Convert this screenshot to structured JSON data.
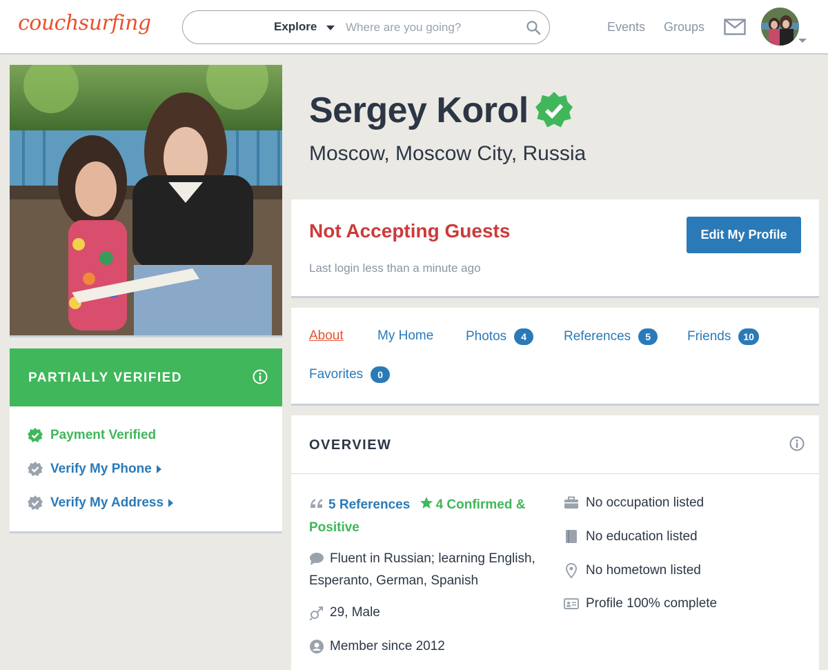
{
  "header": {
    "logo": "couchsurfing",
    "search": {
      "mode": "Explore",
      "placeholder": "Where are you going?"
    },
    "nav": [
      "Events",
      "Groups"
    ],
    "icons": [
      "search-icon",
      "mail-icon",
      "avatar"
    ]
  },
  "profile": {
    "name": "Sergey Korol",
    "location": "Moscow, Moscow City, Russia"
  },
  "verification": {
    "title": "PARTIALLY VERIFIED",
    "items": [
      {
        "label": "Payment Verified",
        "status": "verified"
      },
      {
        "label": "Verify My Phone",
        "status": "unverified"
      },
      {
        "label": "Verify My Address",
        "status": "unverified"
      }
    ]
  },
  "status": {
    "title": "Not Accepting Guests",
    "last_login": "Last login less than a minute ago",
    "edit_button": "Edit My Profile"
  },
  "tabs": [
    {
      "label": "About",
      "active": true
    },
    {
      "label": "My Home"
    },
    {
      "label": "Photos",
      "count": "4"
    },
    {
      "label": "References",
      "count": "5"
    },
    {
      "label": "Friends",
      "count": "10"
    },
    {
      "label": "Favorites",
      "count": "0"
    }
  ],
  "overview": {
    "title": "OVERVIEW",
    "references": "5 References",
    "confirmed": "4 Confirmed & Positive",
    "languages": "Fluent in Russian; learning English, Esperanto, German, Spanish",
    "age_gender": "29, Male",
    "member_since": "Member since 2012",
    "occupation": "No occupation listed",
    "education": "No education listed",
    "hometown": "No hometown listed",
    "profile_completion": "Profile 100% complete"
  },
  "colors": {
    "brand_orange": "#e8512d",
    "link_blue": "#2a7ab8",
    "verified_green": "#3fb75a",
    "alert_red": "#cc3a3a"
  }
}
